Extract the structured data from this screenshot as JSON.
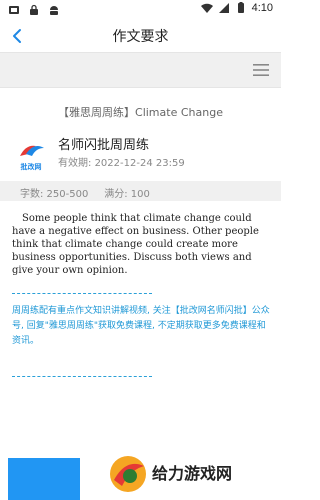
{
  "status": {
    "time": "4:10"
  },
  "header": {
    "title": "作文要求",
    "back_icon": "chevron-left-icon"
  },
  "toolbar": {
    "menu_icon": "hamburger-menu-icon"
  },
  "essay": {
    "title": "【雅思周周练】Climate Change"
  },
  "author": {
    "name": "名师闪批周周练",
    "validity_label": "有效期:",
    "validity_value": "2022-12-24 23:59",
    "logo_text": "批改网"
  },
  "info": {
    "word_count_label": "字数: 250-500",
    "score_label": "满分: 100"
  },
  "prompt": "Some people think that climate change could have a negative effect on business. Other people think that climate change could create more business opportunities. Discuss both views and give your own opinion.",
  "note": "周周练配有重点作文知识讲解视频, 关注【批改网名师闪批】公众号, 回复\"雅思周周练\"获取免费课程, 不定期获取更多免费课程和资讯。",
  "watermark": {
    "text": "给力游戏网"
  },
  "colors": {
    "accent": "#1f98d6",
    "button": "#2196f3"
  }
}
